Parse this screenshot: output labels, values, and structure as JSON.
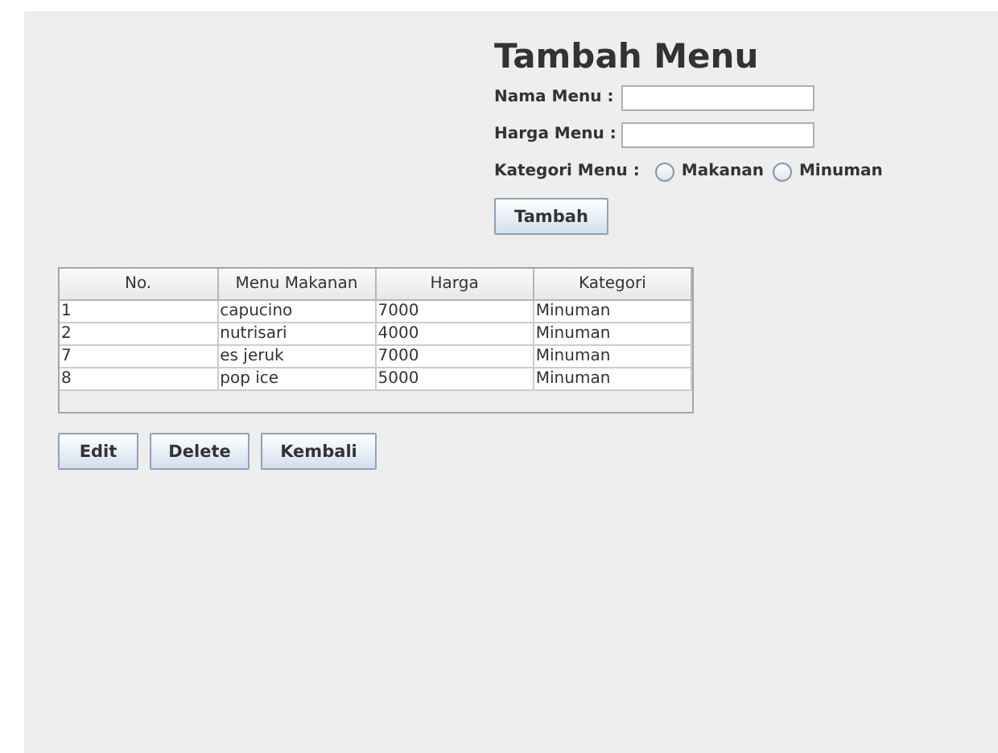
{
  "title": "Tambah Menu",
  "fields": [
    {
      "label": "Nama Menu :"
    },
    {
      "label": "Harga Menu :"
    }
  ],
  "category": {
    "label": "Kategori Menu :",
    "options": [
      {
        "label": "Makanan",
        "selected": false
      },
      {
        "label": "Minuman",
        "selected": false
      }
    ]
  },
  "submit": "Tambah",
  "table": {
    "columns": [
      "No.",
      "Menu Makanan",
      "Harga",
      "Kategori"
    ],
    "rows": [
      [
        "1",
        "capucino",
        "7000",
        "Minuman"
      ],
      [
        "2",
        "nutrisari",
        "4000",
        "Minuman"
      ],
      [
        "7",
        "es jeruk",
        "7000",
        "Minuman"
      ],
      [
        "8",
        "pop ice",
        "5000",
        "Minuman"
      ]
    ]
  },
  "buttons": [
    "Edit",
    "Delete",
    "Kembali"
  ]
}
